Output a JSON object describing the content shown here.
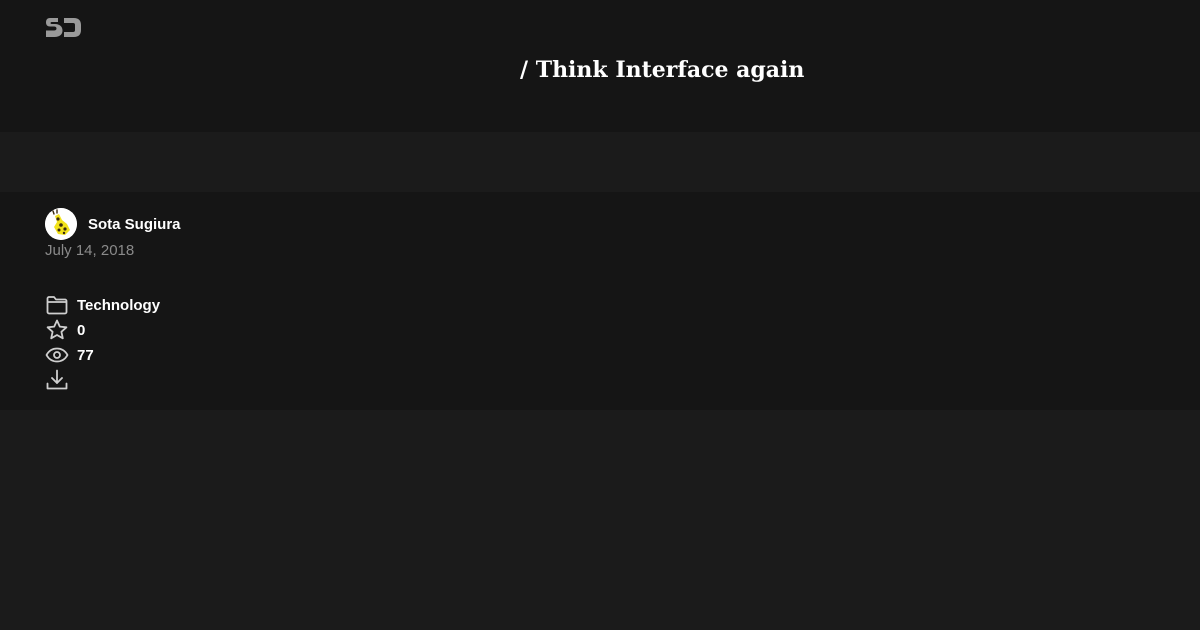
{
  "header": {
    "logo_icon": "speakerdeck-logo-icon",
    "title": "/ Think Interface again"
  },
  "author": {
    "name": "Sota Sugiura",
    "avatar_icon": "giraffe-avatar-icon"
  },
  "deck": {
    "date": "July 14, 2018",
    "category": "Technology",
    "stars": "0",
    "views": "77"
  },
  "icons": {
    "category": "folder-icon",
    "stars": "star-icon",
    "views": "eye-icon",
    "download": "download-icon"
  },
  "colors": {
    "header_bg": "#151515",
    "page_bg": "#1b1b1b",
    "text": "#ffffff",
    "muted_text": "#8a8a8a",
    "logo": "#9a9a9a"
  }
}
